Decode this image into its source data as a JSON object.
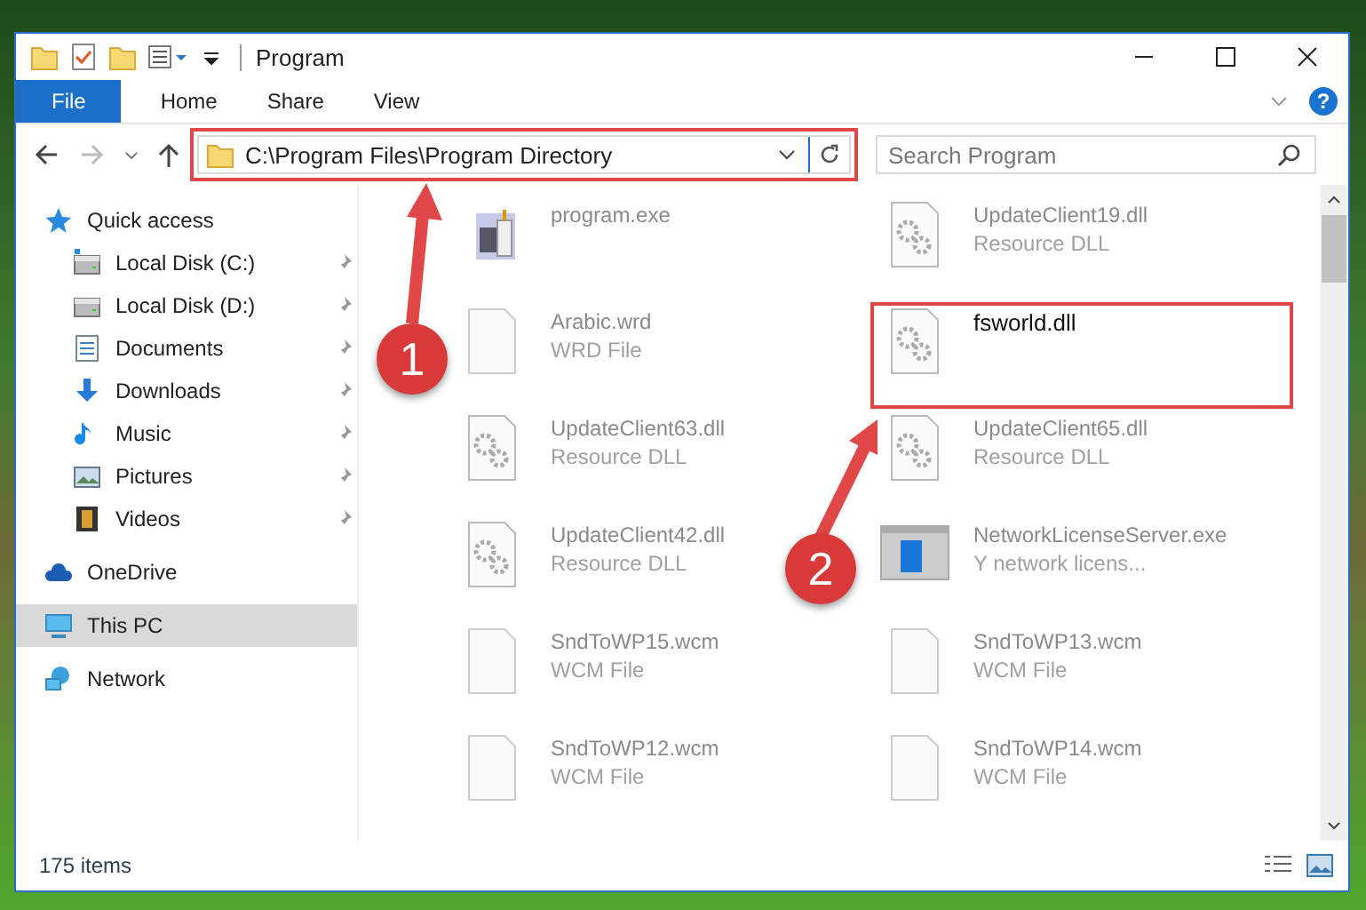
{
  "window": {
    "title": "Program"
  },
  "ribbon_tabs": [
    {
      "label": "File",
      "selected": true
    },
    {
      "label": "Home",
      "selected": false
    },
    {
      "label": "Share",
      "selected": false
    },
    {
      "label": "View",
      "selected": false
    }
  ],
  "help_button": "?",
  "address_bar": {
    "path": "C:\\Program Files\\Program Directory",
    "annotated": true
  },
  "search": {
    "placeholder": "Search Program"
  },
  "sidebar": {
    "items": [
      {
        "label": "Quick access",
        "selected": false,
        "children": [
          {
            "label": "Local Disk (C:)",
            "pinned": true,
            "selected": false
          },
          {
            "label": "Local Disk (D:)",
            "pinned": true,
            "selected": false
          },
          {
            "label": "Documents",
            "pinned": true,
            "selected": false
          },
          {
            "label": "Downloads",
            "pinned": true,
            "selected": false
          },
          {
            "label": "Music",
            "pinned": true,
            "selected": false
          },
          {
            "label": "Pictures",
            "pinned": true,
            "selected": false
          },
          {
            "label": "Videos",
            "pinned": true,
            "selected": false
          }
        ]
      },
      {
        "label": "OneDrive",
        "selected": false
      },
      {
        "label": "This PC",
        "selected": true
      },
      {
        "label": "Network",
        "selected": false
      }
    ]
  },
  "files": [
    {
      "name": "program.exe",
      "kind": "exe",
      "annotated": false
    },
    {
      "name": "UpdateClient19.dll",
      "type": "Resource DLL",
      "kind": "dll",
      "annotated": false
    },
    {
      "name": "Arabic.wrd",
      "type": "WRD File",
      "kind": "doc",
      "annotated": false
    },
    {
      "name": "fsworld.dll",
      "kind": "dll",
      "annotated": true
    },
    {
      "name": "UpdateClient63.dll",
      "type": "Resource DLL",
      "kind": "dll",
      "annotated": false
    },
    {
      "name": "UpdateClient65.dll",
      "type": "Resource DLL",
      "kind": "dll",
      "annotated": false
    },
    {
      "name": "UpdateClient42.dll",
      "type": "Resource DLL",
      "kind": "dll",
      "annotated": false
    },
    {
      "name": "NetworkLicenseServer.exe",
      "type": "Y network licens...",
      "kind": "app",
      "annotated": false
    },
    {
      "name": "SndToWP15.wcm",
      "type": "WCM File",
      "kind": "doc",
      "annotated": false
    },
    {
      "name": "SndToWP13.wcm",
      "type": "WCM File",
      "kind": "doc",
      "annotated": false
    },
    {
      "name": "SndToWP12.wcm",
      "type": "WCM File",
      "kind": "doc",
      "annotated": false
    },
    {
      "name": "SndToWP14.wcm",
      "type": "WCM File",
      "kind": "doc",
      "annotated": false
    }
  ],
  "status_bar": {
    "item_count": "175 items"
  },
  "annotations": [
    {
      "number": "1"
    },
    {
      "number": "2"
    }
  ]
}
